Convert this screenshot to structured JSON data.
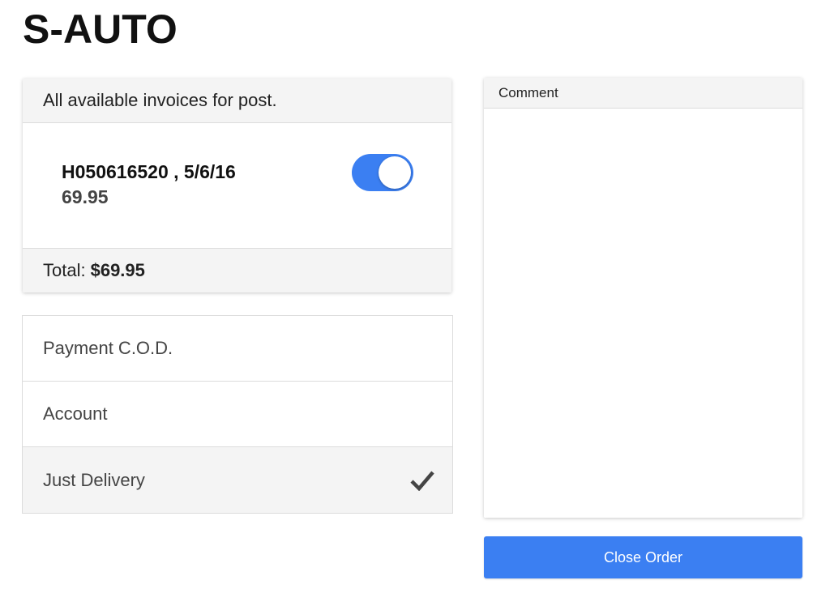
{
  "app": {
    "title": "S-AUTO"
  },
  "invoices": {
    "header": "All available invoices for post.",
    "items": [
      {
        "id_date": "H050616520 , 5/6/16",
        "amount": "69.95",
        "selected": true
      }
    ],
    "total_label": "Total:",
    "total_value": "$69.95"
  },
  "payment": {
    "options": [
      {
        "label": "Payment C.O.D.",
        "selected": false
      },
      {
        "label": "Account",
        "selected": false
      },
      {
        "label": "Just Delivery",
        "selected": true,
        "icon": "checkmark-icon"
      }
    ]
  },
  "comment": {
    "label": "Comment",
    "value": ""
  },
  "actions": {
    "close_order_label": "Close Order"
  },
  "colors": {
    "accent": "#3b7ff2",
    "panel_header_bg": "#f4f4f4",
    "border": "#dcdcdc"
  }
}
